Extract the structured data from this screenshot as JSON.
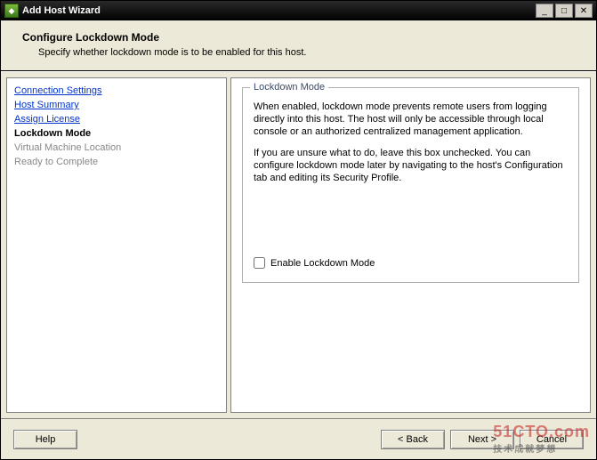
{
  "window": {
    "title": "Add Host Wizard"
  },
  "header": {
    "title": "Configure Lockdown Mode",
    "subtitle": "Specify whether lockdown mode is to be enabled for this host."
  },
  "sidebar": {
    "items": [
      {
        "label": "Connection Settings",
        "state": "link"
      },
      {
        "label": "Host Summary",
        "state": "link"
      },
      {
        "label": "Assign License",
        "state": "link"
      },
      {
        "label": "Lockdown Mode",
        "state": "active"
      },
      {
        "label": "Virtual Machine Location",
        "state": "pending"
      },
      {
        "label": "Ready to Complete",
        "state": "pending"
      }
    ]
  },
  "main": {
    "group_title": "Lockdown Mode",
    "para1": "When enabled, lockdown mode prevents remote users from logging directly into this host. The host will only be accessible through local console or an authorized centralized management application.",
    "para2": "If you are unsure what to do, leave this box unchecked. You can configure lockdown mode later by navigating to the host's Configuration tab and editing its Security Profile.",
    "checkbox_label": "Enable Lockdown Mode",
    "checkbox_checked": false
  },
  "footer": {
    "help": "Help",
    "back": "< Back",
    "next": "Next >",
    "cancel": "Cancel"
  },
  "watermark": {
    "main": "51CTO.com",
    "sub": "技术成就梦想"
  }
}
